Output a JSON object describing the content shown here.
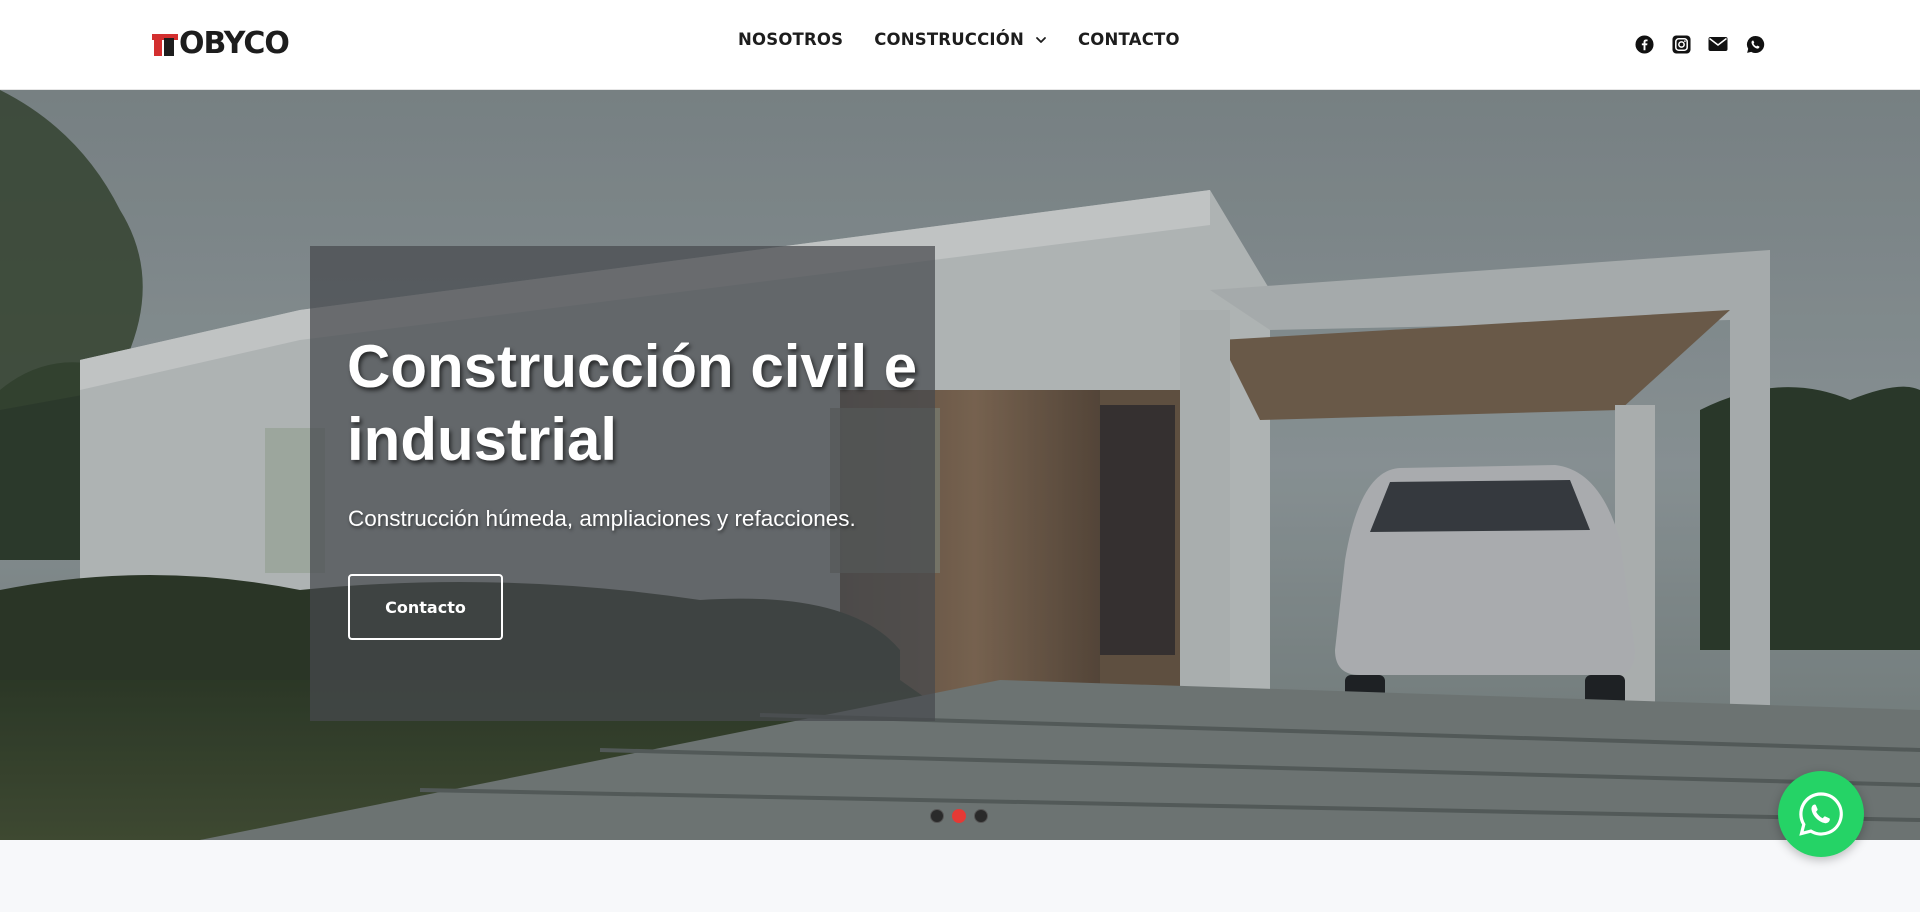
{
  "header": {
    "logo_text": "OBYCO",
    "nav": [
      {
        "label": "NOSOTROS"
      },
      {
        "label": "CONSTRUCCIÓN",
        "has_dropdown": true
      },
      {
        "label": "CONTACTO"
      }
    ],
    "social_icons": [
      "facebook-icon",
      "instagram-icon",
      "mail-icon",
      "whatsapp-icon"
    ]
  },
  "hero": {
    "title": "Construcción civil e industrial",
    "subtitle": "Construcción húmeda, ampliaciones y refacciones.",
    "button_label": "Contacto",
    "slides_total": 3,
    "active_slide": 2
  },
  "colors": {
    "brand_red": "#d32f2f",
    "text_dark": "#1d1d1d",
    "whatsapp_green": "#25d366",
    "active_dot": "#e53935"
  }
}
